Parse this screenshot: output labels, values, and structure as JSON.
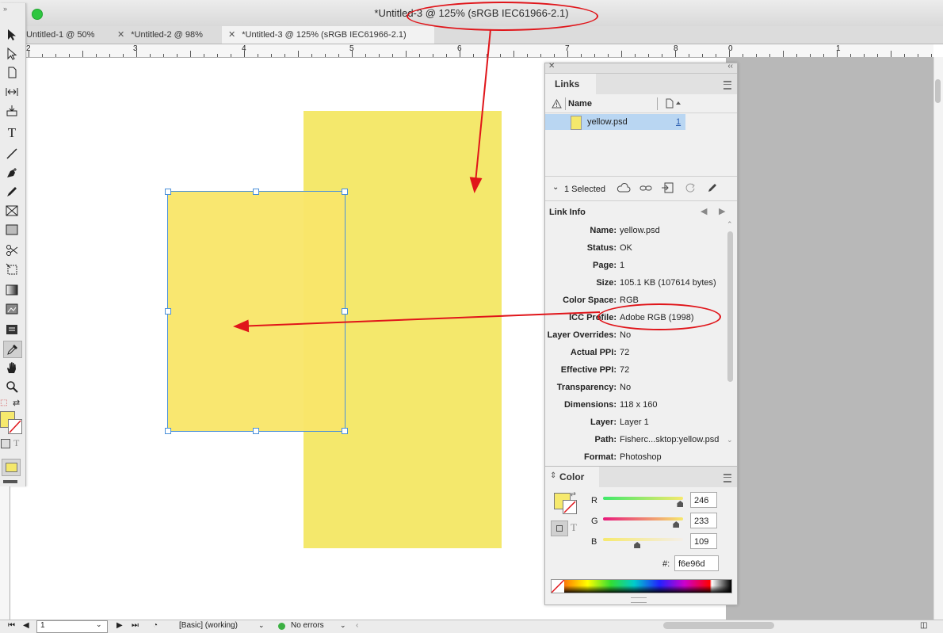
{
  "window": {
    "title": "*Untitled-3 @ 125% (sRGB IEC61966-2.1)"
  },
  "tabs": [
    {
      "label": "Untitled-1 @ 50%"
    },
    {
      "label": "*Untitled-2 @ 98%"
    },
    {
      "label": "*Untitled-3 @ 125% (sRGB IEC61966-2.1)"
    }
  ],
  "ruler": {
    "labels": [
      "2",
      "3",
      "4",
      "5",
      "6",
      "7",
      "8",
      "0",
      "1"
    ]
  },
  "links_panel": {
    "tab_label": "Links",
    "col_name": "Name",
    "items": [
      {
        "name": "yellow.psd",
        "page": "1"
      }
    ],
    "selected_text": "1 Selected",
    "link_info_label": "Link Info",
    "info": [
      {
        "label": "Name:",
        "value": "yellow.psd"
      },
      {
        "label": "Status:",
        "value": "OK"
      },
      {
        "label": "Page:",
        "value": "1"
      },
      {
        "label": "Size:",
        "value": "105.1 KB (107614 bytes)"
      },
      {
        "label": "Color Space:",
        "value": "RGB"
      },
      {
        "label": "ICC Profile:",
        "value": "Adobe RGB (1998)"
      },
      {
        "label": "Layer Overrides:",
        "value": "No"
      },
      {
        "label": "Actual PPI:",
        "value": "72"
      },
      {
        "label": "Effective PPI:",
        "value": "72"
      },
      {
        "label": "Transparency:",
        "value": "No"
      },
      {
        "label": "Dimensions:",
        "value": "118 x 160"
      },
      {
        "label": "Layer:",
        "value": "Layer 1"
      },
      {
        "label": "Path:",
        "value": "Fisherc...sktop:yellow.psd"
      },
      {
        "label": "Format:",
        "value": "Photoshop"
      }
    ]
  },
  "color_panel": {
    "tab_label": "Color",
    "r_label": "R",
    "g_label": "G",
    "b_label": "B",
    "r": "246",
    "g": "233",
    "b": "109",
    "hex_label": "#:",
    "hex": "f6e96d",
    "swatch_color": "#f6e96d",
    "levels": {
      "r": 0.965,
      "g": 0.914,
      "b": 0.427
    }
  },
  "status_bar": {
    "page": "1",
    "preflight_profile": "[Basic] (working)",
    "errors": "No errors",
    "error_color": "#3cb043"
  },
  "colors": {
    "yellow": "#f4e86c",
    "selection": "#4a90d9",
    "annotation": "#e0151a"
  }
}
